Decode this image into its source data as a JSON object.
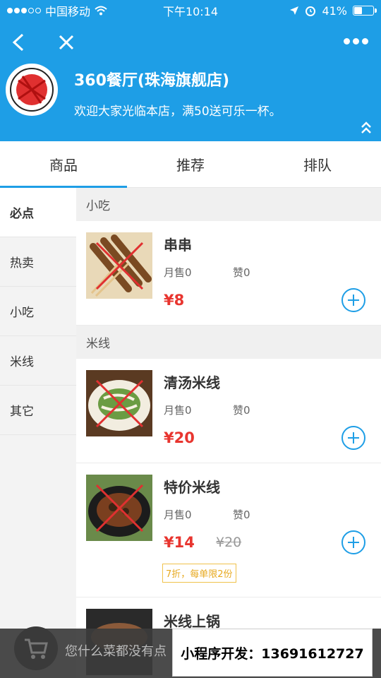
{
  "status_bar": {
    "carrier": "中国移动",
    "time": "下午10:14",
    "battery_percent": "41%",
    "battery_level": 0.41
  },
  "header": {
    "shop_name": "360餐厅(珠海旗舰店)",
    "notice": "欢迎大家光临本店，满50送可乐一杯。",
    "accent_color": "#1e9ee6"
  },
  "tabs": [
    {
      "label": "商品"
    },
    {
      "label": "推荐"
    },
    {
      "label": "排队"
    }
  ],
  "sidebar": {
    "items": [
      {
        "label": "必点"
      },
      {
        "label": "热卖"
      },
      {
        "label": "小吃"
      },
      {
        "label": "米线"
      },
      {
        "label": "其它"
      }
    ]
  },
  "menu": {
    "sections": [
      {
        "title": "小吃",
        "items": [
          {
            "name": "串串",
            "sales": "月售0",
            "likes": "赞0",
            "price": "¥8"
          }
        ]
      },
      {
        "title": "米线",
        "items": [
          {
            "name": "清汤米线",
            "sales": "月售0",
            "likes": "赞0",
            "price": "¥20"
          },
          {
            "name": "特价米线",
            "sales": "月售0",
            "likes": "赞0",
            "price": "¥14",
            "old_price": "¥20",
            "tag": "7折，每单限2份"
          },
          {
            "name": "米线上锅"
          }
        ]
      }
    ]
  },
  "cart": {
    "empty_text": "您什么菜都没有点",
    "dev_text": "小程序开发：13691612727"
  }
}
